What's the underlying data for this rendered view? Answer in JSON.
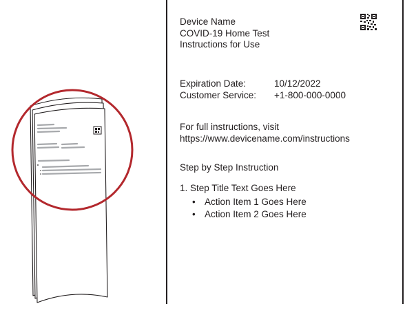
{
  "doc": {
    "header_lines": [
      "Device Name",
      "COVID-19 Home Test",
      "Instructions for Use"
    ],
    "expiration_label": "Expiration Date:",
    "expiration_value": "10/12/2022",
    "service_label": "Customer Service:",
    "service_value": "+1-800-000-0000",
    "full_instructions_line1": "For full instructions, visit",
    "full_instructions_url": "https://www.devicename.com/instructions",
    "section_title": "Step by Step Instruction",
    "step_title": "1.  Step Title Text Goes Here",
    "step_items": [
      "Action Item 1 Goes Here",
      "Action Item 2 Goes Here"
    ]
  },
  "colors": {
    "highlight_circle": "#b3282d",
    "line_art": "#231f20",
    "placeholder_text": "#a7a9ac"
  },
  "icons": {
    "qr": "qr-code-icon"
  }
}
